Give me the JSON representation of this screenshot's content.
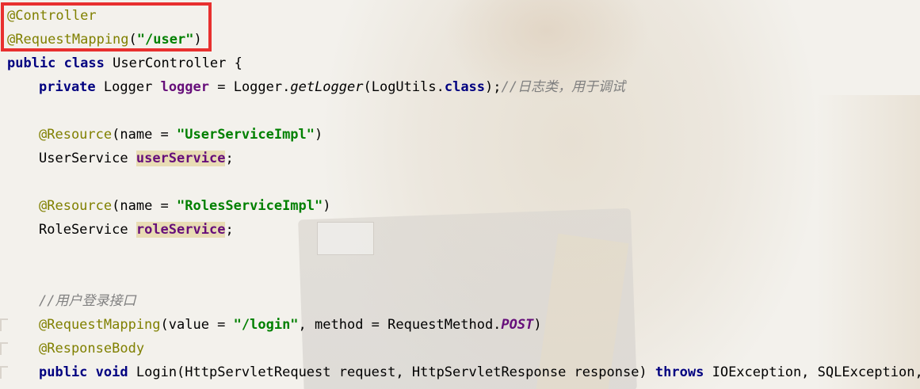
{
  "lines": {
    "l1": {
      "ann": "@Controller"
    },
    "l2": {
      "ann": "@RequestMapping",
      "open": "(",
      "str": "\"/user\"",
      "close": ")"
    },
    "l3": {
      "kw1": "public",
      "kw2": "class",
      "rest": "UserController {"
    },
    "l4": {
      "kw": "private",
      "type": "Logger",
      "field": "logger",
      "eq": " = Logger.",
      "call": "getLogger",
      "args": "(LogUtils.",
      "cls": "class",
      "end": ");",
      "comment": "//日志类，用于调试"
    },
    "l6": {
      "ann": "@Resource",
      "pre": "(name = ",
      "str": "\"UserServiceImpl\"",
      "close": ")"
    },
    "l7": {
      "type": "UserService",
      "field": "userService",
      "end": ";"
    },
    "l9": {
      "ann": "@Resource",
      "pre": "(name = ",
      "str": "\"RolesServiceImpl\"",
      "close": ")"
    },
    "l10": {
      "type": "RoleService",
      "field": "roleService",
      "end": ";"
    },
    "l13": {
      "comment": "//用户登录接口"
    },
    "l14": {
      "ann": "@RequestMapping",
      "pre": "(value = ",
      "str": "\"/login\"",
      "mid": ", method = RequestMethod.",
      "const": "POST",
      "close": ")"
    },
    "l15": {
      "ann": "@ResponseBody"
    },
    "l16": {
      "kw1": "public",
      "kw2": "void",
      "sig": "Login(HttpServletRequest request, HttpServletResponse response)",
      "kw3": "throws",
      "exc": "IOException, SQLException,"
    }
  },
  "colors": {
    "annotation": "#808000",
    "keyword": "#000080",
    "string": "#008000",
    "field": "#660e7a",
    "comment": "#808080",
    "highlight": "#e8dcb4",
    "redbox": "#e8302f"
  }
}
